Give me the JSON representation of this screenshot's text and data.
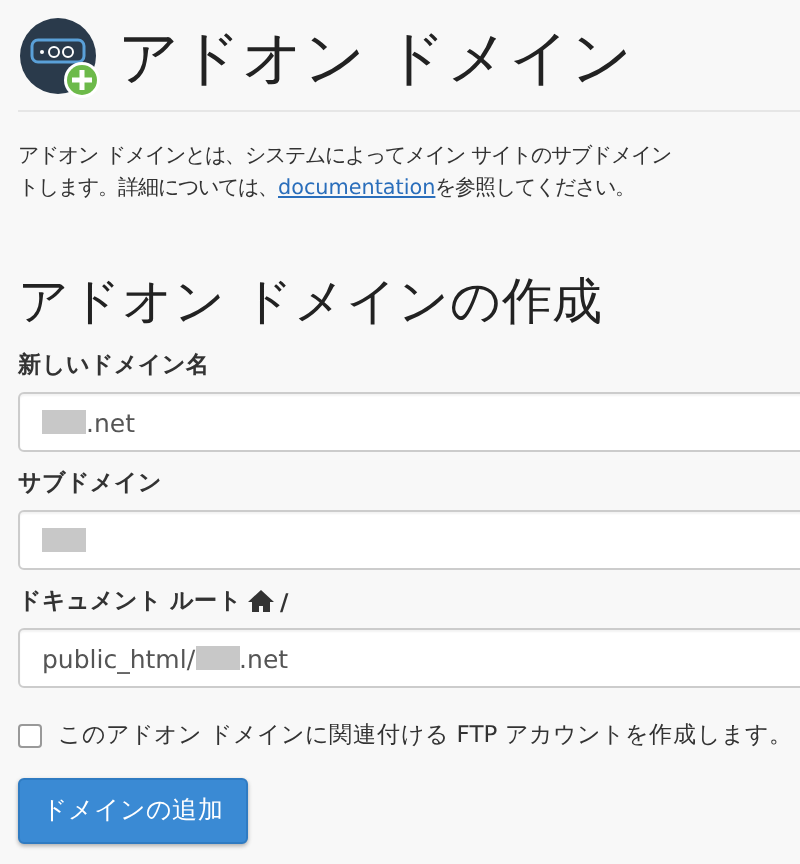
{
  "header": {
    "title": "アドオン ドメイン"
  },
  "description": {
    "line_1": "アドオン ドメインとは、システムによってメイン サイトのサブドメイン",
    "line_2_before": "トします。詳細については、",
    "link": "documentation",
    "line_2_after": "を参照してください。"
  },
  "form": {
    "heading": "アドオン ドメインの作成",
    "fields": [
      {
        "label": "新しいドメイン名",
        "value_after": ".net",
        "home_icon": false
      },
      {
        "label": "サブドメイン",
        "home_icon": false
      },
      {
        "label": "ドキュメント ルート",
        "value_before": "public_html/",
        "value_after": ".net",
        "home_icon": true,
        "label_suffix": "/"
      }
    ],
    "ftp_checkbox": {
      "label": "このアドオン ドメインに関連付ける FTP アカウントを作成します。",
      "checked": false
    },
    "submit_button": "ドメインの追加"
  }
}
